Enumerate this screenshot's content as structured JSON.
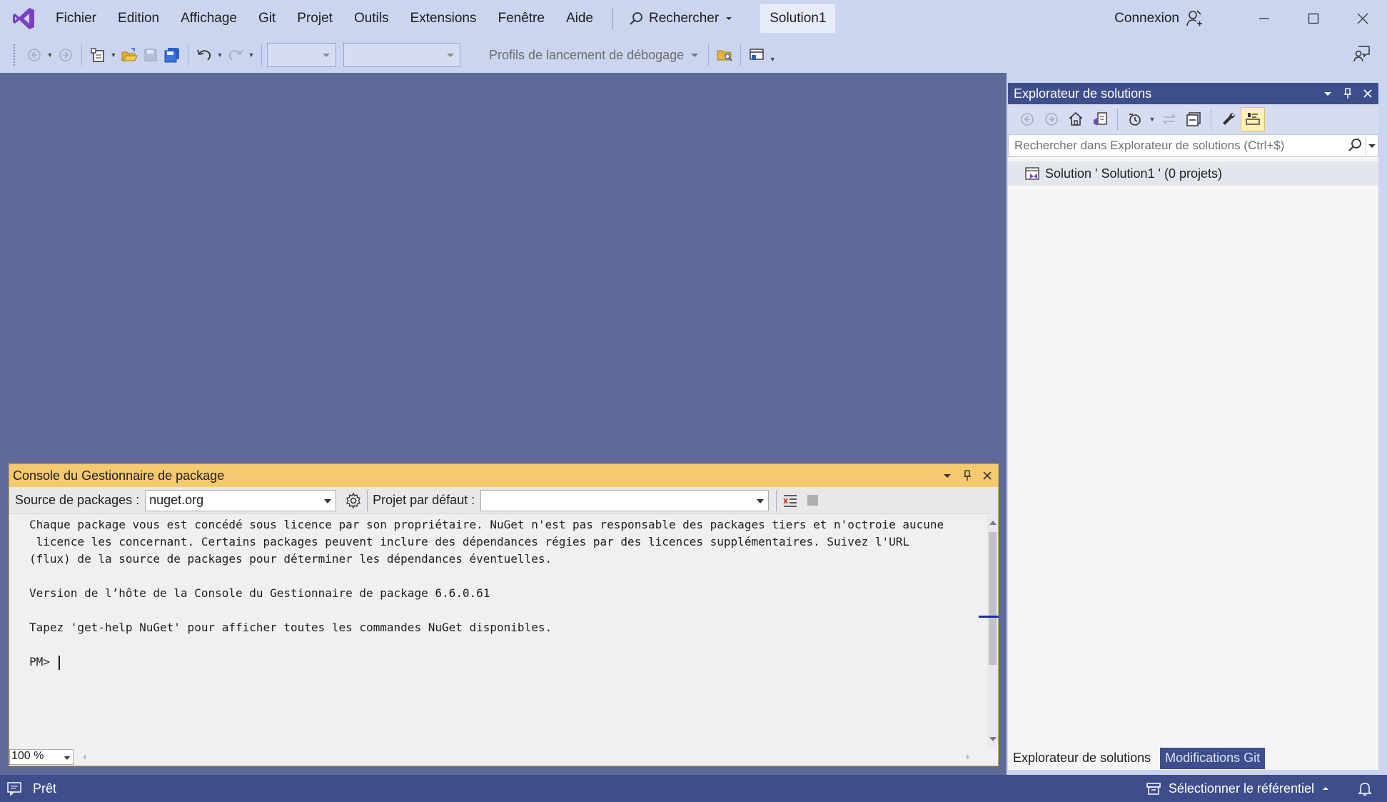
{
  "menu": {
    "items": [
      "Fichier",
      "Edition",
      "Affichage",
      "Git",
      "Projet",
      "Outils",
      "Extensions",
      "Fenêtre",
      "Aide"
    ],
    "search_label": "Rechercher",
    "solution_name": "Solution1",
    "connexion_label": "Connexion"
  },
  "toolbar": {
    "debug_profiles_label": "Profils de lancement de débogage"
  },
  "solution_explorer": {
    "title": "Explorateur de solutions",
    "search_placeholder": "Rechercher dans Explorateur de solutions (Ctrl+$)",
    "tree_item": "Solution ' Solution1 ' (0 projets)",
    "tabs": [
      "Explorateur de solutions",
      "Modifications Git"
    ]
  },
  "pmc": {
    "title": "Console du Gestionnaire de package",
    "source_label": "Source de packages :",
    "source_value": "nuget.org",
    "default_project_label": "Projet par défaut :",
    "default_project_value": "",
    "lines": [
      "Chaque package vous est concédé sous licence par son propriétaire. NuGet n'est pas responsable des packages tiers et n'octroie aucune",
      " licence les concernant. Certains packages peuvent inclure des dépendances régies par des licences supplémentaires. Suivez l'URL",
      "(flux) de la source de packages pour déterminer les dépendances éventuelles.",
      "",
      "Version de l’hôte de la Console du Gestionnaire de package 6.6.0.61",
      "",
      "Tapez 'get-help NuGet' pour afficher toutes les commandes NuGet disponibles.",
      ""
    ],
    "prompt": "PM>",
    "zoom": "100 %"
  },
  "status": {
    "ready": "Prêt",
    "select_repo": "Sélectionner le référentiel"
  },
  "colors": {
    "vs_purple": "#7b3fbf",
    "main_bg": "#5e6a98",
    "panel_header": "#3e4e8c",
    "pmc_header": "#f5c96e",
    "chrome_bg": "#ccd5f0"
  }
}
